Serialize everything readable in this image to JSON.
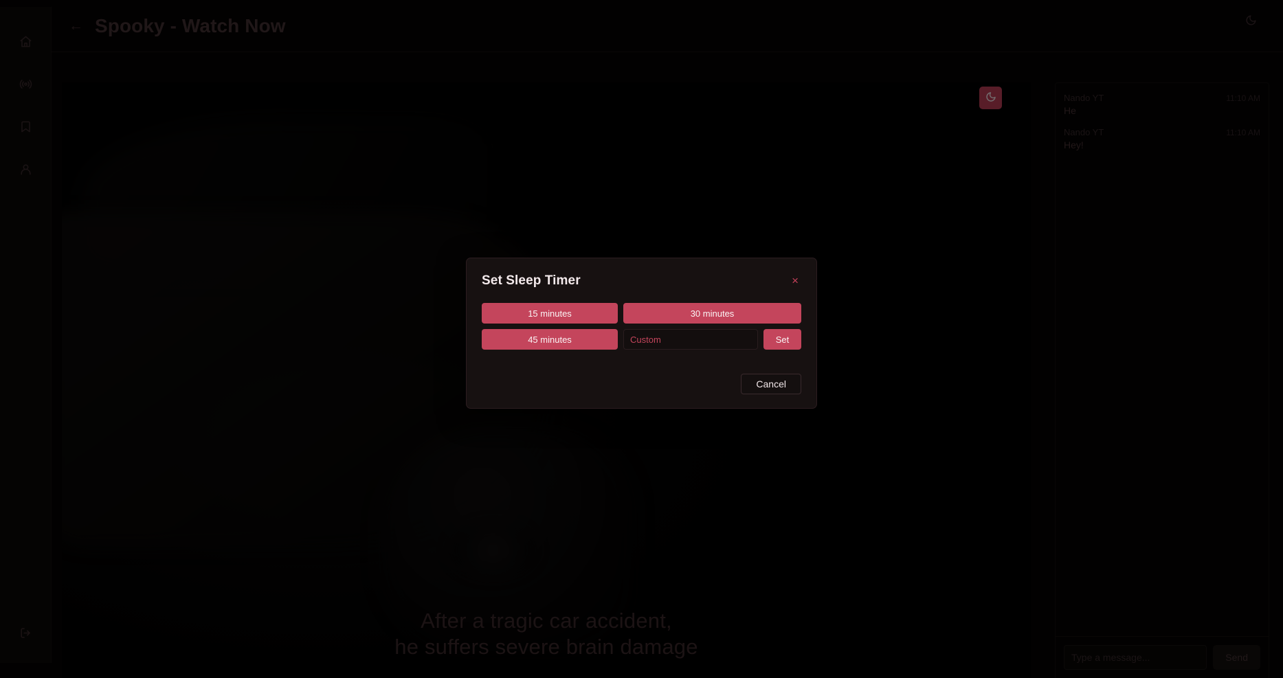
{
  "sidebar": {
    "items": [
      {
        "icon": "home-icon",
        "name": "sidebar-item-home"
      },
      {
        "icon": "broadcast-icon",
        "name": "sidebar-item-live"
      },
      {
        "icon": "bookmark-icon",
        "name": "sidebar-item-saved"
      },
      {
        "icon": "user-icon",
        "name": "sidebar-item-profile"
      }
    ],
    "logout": {
      "icon": "logout-icon",
      "name": "sidebar-item-logout"
    }
  },
  "header": {
    "back_label": "←",
    "title": "Spooky - Watch Now",
    "theme_toggle_icon": "moon-icon"
  },
  "player": {
    "sleep_timer_icon": "moon-icon",
    "subtitle_lines": [
      "After a tragic car accident,",
      "he suffers severe brain damage"
    ]
  },
  "chat": {
    "messages": [
      {
        "author": "Nando YT",
        "time": "11:10 AM",
        "text": "He"
      },
      {
        "author": "Nando YT",
        "time": "11:10 AM",
        "text": "Hey!"
      }
    ],
    "input_placeholder": "Type a message...",
    "input_value": "",
    "send_label": "Send"
  },
  "modal": {
    "title": "Set Sleep Timer",
    "close_label": "×",
    "presets": [
      {
        "label": "15 minutes"
      },
      {
        "label": "30 minutes"
      },
      {
        "label": "45 minutes"
      }
    ],
    "custom_placeholder": "Custom",
    "custom_value": "",
    "set_label": "Set",
    "cancel_label": "Cancel"
  },
  "colors": {
    "accent": "#c4455c",
    "accent_alt": "#c4405a",
    "modal_bg": "#171111",
    "app_bg": "#050303",
    "sidebar_bg": "#0c0908"
  }
}
